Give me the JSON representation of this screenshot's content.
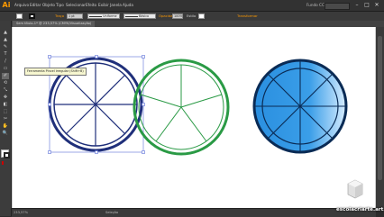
{
  "app": {
    "logo": "Ai",
    "accent": "#ff9a00"
  },
  "menu": [
    "Arquivo",
    "Editar",
    "Objeto",
    "Tipo",
    "Selecionar",
    "Efeito",
    "Exibir",
    "Janela",
    "Ajuda"
  ],
  "menu_right": {
    "workspace": "Fundo CC",
    "search_placeholder": ""
  },
  "window_controls": {
    "minimize": "–",
    "maximize": "□",
    "close": "✕"
  },
  "control_bar": {
    "traco_label": "Traço",
    "stroke_weight": "1 pt",
    "uniform_label": "Uniforme",
    "brush_label": "Básico",
    "opacity_label": "Opacidade",
    "opacity_value": "100%",
    "style_label": "Estilo",
    "transform_label": "Transformar",
    "highlight_color": "#ff9a00"
  },
  "document": {
    "tab_title": "Sem título-1* @ 233,57% (CMYK/Visualização)",
    "close": "✕"
  },
  "tools": [
    "▲",
    "▲",
    "✎",
    "T",
    "/",
    "▭",
    "✐",
    "⟲",
    "⤡",
    "✥",
    "◧",
    "⬚",
    "✂",
    "✋",
    "🔍"
  ],
  "tooltip": "Ferramenta Pincel irregular (Shift+B)",
  "status": {
    "zoom": "233,57%",
    "tool_name": "Seleção"
  },
  "watermark": "escolacriarte.art.br",
  "colors": {
    "circle1_stroke": "#1f2f7a",
    "circle2_stroke": "#2a9a45",
    "circle3_dark": "#0a3d7a",
    "circle3_light": "#c9e7ff",
    "circle3_mid": "#2a8fe0",
    "selection": "#5b6fd8"
  }
}
